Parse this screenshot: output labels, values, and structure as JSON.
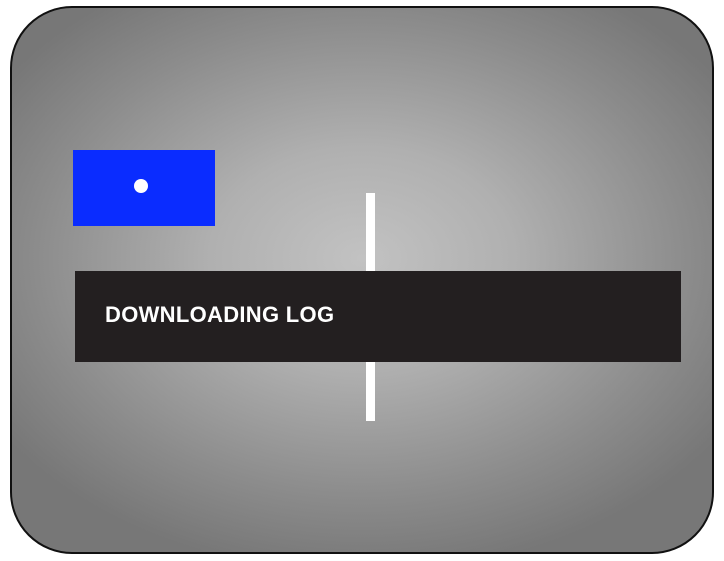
{
  "status": {
    "message": "DOWNLOADING LOG",
    "indicator_color": "#0a2cff",
    "banner_color": "#231f20"
  }
}
